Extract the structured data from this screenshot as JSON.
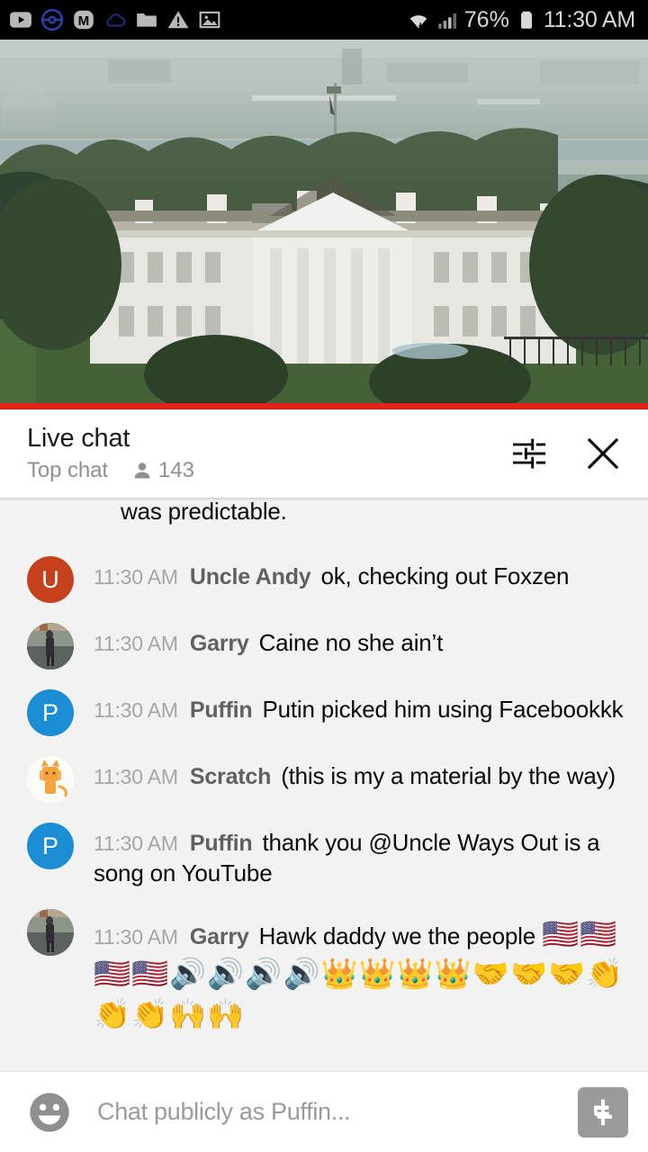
{
  "statusbar": {
    "icons": [
      "youtube-icon",
      "pokeball-icon",
      "m-badge-icon",
      "cloud-icon",
      "folder-icon",
      "warning-icon",
      "image-icon"
    ],
    "battery_percent": "76%",
    "time": "11:30 AM",
    "wifi_icon": "wifi-transfer-icon",
    "signal_icon": "cell-signal-icon",
    "battery_icon": "battery-icon"
  },
  "video": {
    "description": "white-house-live-stream",
    "progress_color": "#e62117"
  },
  "chat_header": {
    "title": "Live chat",
    "mode": "Top chat",
    "viewer_count": "143",
    "viewer_icon": "person-icon",
    "settings_icon": "chat-settings-icon",
    "close_icon": "close-icon"
  },
  "messages": [
    {
      "partial": true,
      "text": "was predictable."
    },
    {
      "time": "11:30 AM",
      "author": "Uncle Andy",
      "text": "ok, checking out Foxzen",
      "avatar_type": "letter",
      "avatar_letter": "U",
      "avatar_color": "#c5411e"
    },
    {
      "time": "11:30 AM",
      "author": "Garry",
      "text": "Caine no she ain’t",
      "avatar_type": "photo-person",
      "avatar_color": "#6e7a74"
    },
    {
      "time": "11:30 AM",
      "author": "Puffin",
      "text": "Putin picked him using Facebookkk",
      "avatar_type": "letter",
      "avatar_letter": "P",
      "avatar_color": "#1b8dd4"
    },
    {
      "time": "11:30 AM",
      "author": "Scratch",
      "text": "(this is my a material by the way)",
      "avatar_type": "cat",
      "avatar_color": "#ffffff"
    },
    {
      "time": "11:30 AM",
      "author": "Puffin",
      "text": "thank you @Uncle Ways Out is a song on YouTube",
      "avatar_type": "letter",
      "avatar_letter": "P",
      "avatar_color": "#1b8dd4"
    },
    {
      "time": "11:30 AM",
      "author": "Garry",
      "text": "Hawk daddy we the people ",
      "emoji": "🇺🇸🇺🇸🇺🇸🇺🇸🔊🔊🔊🔊👑👑👑👑🤝🤝🤝👏👏👏🙌🙌",
      "avatar_type": "photo-person",
      "avatar_color": "#6e7a74"
    }
  ],
  "input_bar": {
    "emoji_icon": "emoji-smiley-icon",
    "placeholder": "Chat publicly as Puffin...",
    "superchat_icon": "dollar-icon"
  }
}
